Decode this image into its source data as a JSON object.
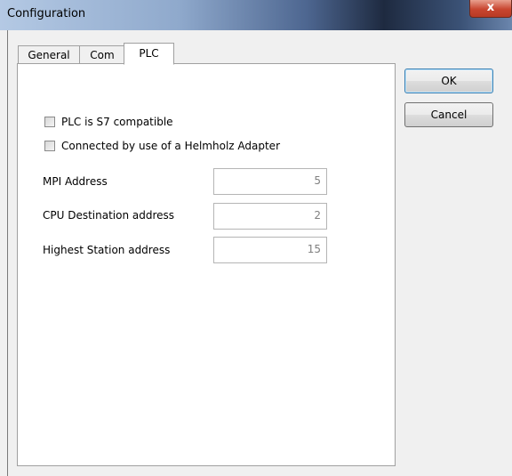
{
  "window": {
    "title": "Configuration",
    "close_glyph": "x"
  },
  "tabs": [
    {
      "label": "General",
      "active": false
    },
    {
      "label": "Com",
      "active": false
    },
    {
      "label": "PLC",
      "active": true
    }
  ],
  "checkboxes": [
    {
      "label": "PLC is S7 compatible",
      "checked": false
    },
    {
      "label": "Connected by use of a Helmholz Adapter",
      "checked": false
    }
  ],
  "fields": [
    {
      "label": "MPI Address",
      "value": "5"
    },
    {
      "label": "CPU Destination address",
      "value": "2"
    },
    {
      "label": "Highest Station address",
      "value": "15"
    }
  ],
  "buttons": {
    "ok": "OK",
    "cancel": "Cancel"
  }
}
